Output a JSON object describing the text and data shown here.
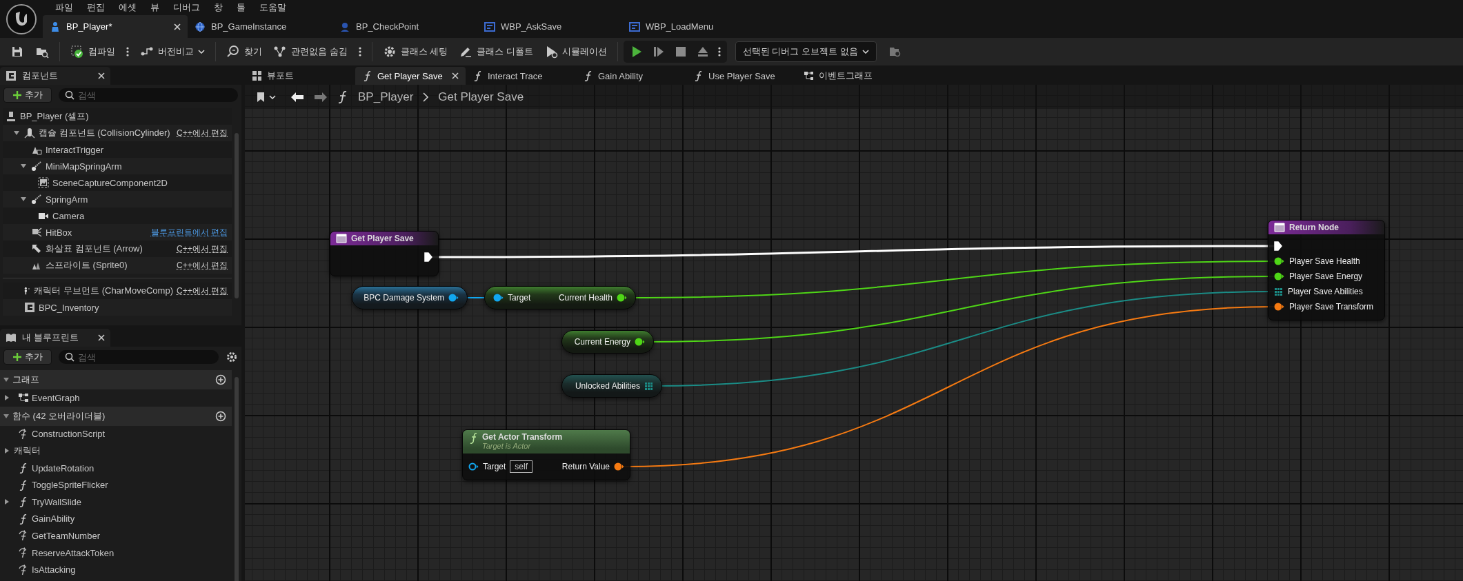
{
  "menu_bar": [
    "파일",
    "편집",
    "에셋",
    "뷰",
    "디버그",
    "창",
    "툴",
    "도움말"
  ],
  "document_tabs": [
    {
      "label": "BP_Player*",
      "kind": "pawn",
      "selected": true
    },
    {
      "label": "BP_GameInstance",
      "kind": "game-instance",
      "selected": false
    },
    {
      "label": "BP_CheckPoint",
      "kind": "actor",
      "selected": false
    },
    {
      "label": "WBP_AskSave",
      "kind": "widget",
      "selected": false
    },
    {
      "label": "WBP_LoadMenu",
      "kind": "widget",
      "selected": false
    }
  ],
  "toolbar": [
    {
      "kind": "save"
    },
    {
      "kind": "browse"
    },
    {
      "kind": "separator"
    },
    {
      "kind": "compile",
      "label": "컴파일",
      "more": true
    },
    {
      "kind": "diff",
      "label": "버전비교",
      "dropdown": true
    },
    {
      "kind": "separator"
    },
    {
      "kind": "find",
      "label": "찾기"
    },
    {
      "kind": "hide-unrelated",
      "label": "관련없음 숨김",
      "more": true
    },
    {
      "kind": "separator"
    },
    {
      "kind": "class-settings",
      "label": "클래스 세팅"
    },
    {
      "kind": "class-defaults",
      "label": "클래스 디폴트"
    },
    {
      "kind": "simulation",
      "label": "시뮬레이션"
    },
    {
      "kind": "separator"
    },
    {
      "kind": "play-controls",
      "more": true,
      "buttons": [
        {
          "kind": "play",
          "disabled": false
        },
        {
          "kind": "step",
          "disabled": true
        },
        {
          "kind": "stop",
          "disabled": true
        },
        {
          "kind": "eject",
          "disabled": true
        }
      ]
    },
    {
      "kind": "debug-select",
      "value": "선택된 디버그 오브젝트 없음",
      "dropdown": true
    },
    {
      "kind": "find-in-browser"
    }
  ],
  "components_panel": {
    "title": "컴포넌트",
    "add_button": "추가",
    "search_placeholder": "검색",
    "tree": {
      "label": "BP_Player (셀프)",
      "kind": "actor",
      "children": [
        {
          "label": "캡슐 컴포넌트 (CollisionCylinder)",
          "kind": "capsule",
          "edit_link": {
            "label": "C++에서 편집",
            "kind": "cpp"
          },
          "expanded": true,
          "children": [
            {
              "label": "InteractTrigger",
              "kind": "trigger"
            },
            {
              "label": "MiniMapSpringArm",
              "kind": "spring-arm",
              "expanded": true,
              "children": [
                {
                  "label": "SceneCaptureComponent2D",
                  "kind": "scene-capture"
                }
              ]
            },
            {
              "label": "SpringArm",
              "kind": "spring-arm",
              "expanded": true,
              "children": [
                {
                  "label": "Camera",
                  "kind": "camera"
                }
              ]
            },
            {
              "label": "HitBox",
              "kind": "hitbox",
              "edit_link": {
                "label": "블루프린트에서 편집",
                "kind": "blueprint"
              }
            },
            {
              "label": "화살표 컴포넌트 (Arrow)",
              "kind": "arrow",
              "edit_link": {
                "label": "C++에서 편집",
                "kind": "cpp"
              }
            },
            {
              "label": "스프라이트 (Sprite0)",
              "kind": "sprite",
              "edit_link": {
                "label": "C++에서 편집",
                "kind": "cpp"
              }
            }
          ]
        }
      ]
    },
    "other_components": [
      {
        "label": "캐릭터 무브먼트 (CharMoveComp)",
        "kind": "movement",
        "edit_link": {
          "label": "C++에서 편집",
          "kind": "cpp"
        }
      },
      {
        "label": "BPC_Inventory",
        "kind": "component"
      }
    ]
  },
  "my_blueprint_panel": {
    "title": "내 블루프린트",
    "add_button": "추가",
    "search_placeholder": "검색",
    "sections": [
      {
        "title": "그래프",
        "expanded": true,
        "items": [
          {
            "label": "EventGraph",
            "kind": "graph",
            "expanded": false
          }
        ]
      },
      {
        "title": "함수 (42 오버라이더블)",
        "expanded": true,
        "items": [
          {
            "label": "ConstructionScript",
            "kind": "override"
          },
          {
            "label": "캐릭터",
            "kind": "category",
            "expanded": false
          },
          {
            "label": "UpdateRotation",
            "kind": "function"
          },
          {
            "label": "ToggleSpriteFlicker",
            "kind": "function"
          },
          {
            "label": "TryWallSlide",
            "kind": "function",
            "expanded": false
          },
          {
            "label": "GainAbility",
            "kind": "function"
          },
          {
            "label": "GetTeamNumber",
            "kind": "override"
          },
          {
            "label": "ReserveAttackToken",
            "kind": "override"
          },
          {
            "label": "IsAttacking",
            "kind": "override"
          }
        ]
      }
    ]
  },
  "graph_tabs": [
    {
      "label": "뷰포트",
      "kind": "viewport",
      "selected": false
    },
    {
      "label": "Get Player Save",
      "kind": "function",
      "selected": true
    },
    {
      "label": "Interact Trace",
      "kind": "function",
      "selected": false
    },
    {
      "label": "Gain Ability",
      "kind": "function",
      "selected": false
    },
    {
      "label": "Use Player Save",
      "kind": "function",
      "selected": false
    },
    {
      "label": "이벤트그래프",
      "kind": "event-graph",
      "selected": false
    }
  ],
  "breadcrumb": {
    "back_enabled": true,
    "forward_enabled": false,
    "path": [
      "BP_Player",
      "Get Player Save"
    ]
  },
  "graph": {
    "nodes": [
      {
        "kind": "entry",
        "title": "Get Player Save",
        "outputs": [
          {
            "kind": "exec",
            "connected": true
          }
        ]
      },
      {
        "kind": "variable",
        "outputs": [
          {
            "label": "BPC Damage System",
            "kind": "object",
            "connected": true
          }
        ]
      },
      {
        "kind": "getter",
        "inputs": [
          {
            "label": "Target",
            "kind": "object",
            "connected": true
          }
        ],
        "outputs": [
          {
            "label": "Current Health",
            "kind": "float",
            "connected": true
          }
        ]
      },
      {
        "kind": "variable",
        "outputs": [
          {
            "label": "Current Energy",
            "kind": "float",
            "connected": true
          }
        ]
      },
      {
        "kind": "variable",
        "outputs": [
          {
            "label": "Unlocked Abilities",
            "kind": "array",
            "connected": true
          }
        ]
      },
      {
        "kind": "function",
        "title": "Get Actor Transform",
        "subtitle": "Target is Actor",
        "inputs": [
          {
            "label": "Target",
            "kind": "object",
            "connected": false,
            "default": "self"
          }
        ],
        "outputs": [
          {
            "label": "Return Value",
            "kind": "transform",
            "connected": true
          }
        ]
      },
      {
        "kind": "return",
        "title": "Return Node",
        "inputs": [
          {
            "kind": "exec",
            "connected": true
          },
          {
            "label": "Player Save Health",
            "kind": "float",
            "connected": true
          },
          {
            "label": "Player Save Energy",
            "kind": "float",
            "connected": true
          },
          {
            "label": "Player Save Abilities",
            "kind": "array",
            "connected": true
          },
          {
            "label": "Player Save Transform",
            "kind": "transform",
            "connected": true
          }
        ]
      }
    ]
  }
}
